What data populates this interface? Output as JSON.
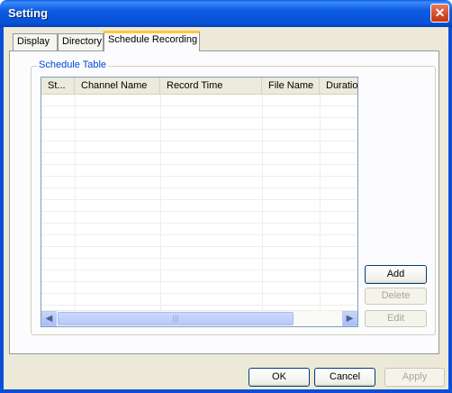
{
  "window": {
    "title": "Setting",
    "close_glyph": "✕"
  },
  "tabs": [
    {
      "label": "Display"
    },
    {
      "label": "Directory"
    },
    {
      "label": "Schedule Recording",
      "active": true
    }
  ],
  "schedule": {
    "group_label": "Schedule Table",
    "columns": [
      "St...",
      "Channel Name",
      "Record Time",
      "File Name",
      "Duratio"
    ],
    "rows": [],
    "hscroll": {
      "left": "◀",
      "right": "▶",
      "grip": "|||"
    }
  },
  "side_buttons": {
    "add": "Add",
    "delete": "Delete",
    "edit": "Edit"
  },
  "footer": {
    "ok": "OK",
    "cancel": "Cancel",
    "apply": "Apply"
  },
  "colors": {
    "titlebar": "#0751d6",
    "accent_tab": "#ffc83c",
    "group_label": "#0046d5"
  }
}
